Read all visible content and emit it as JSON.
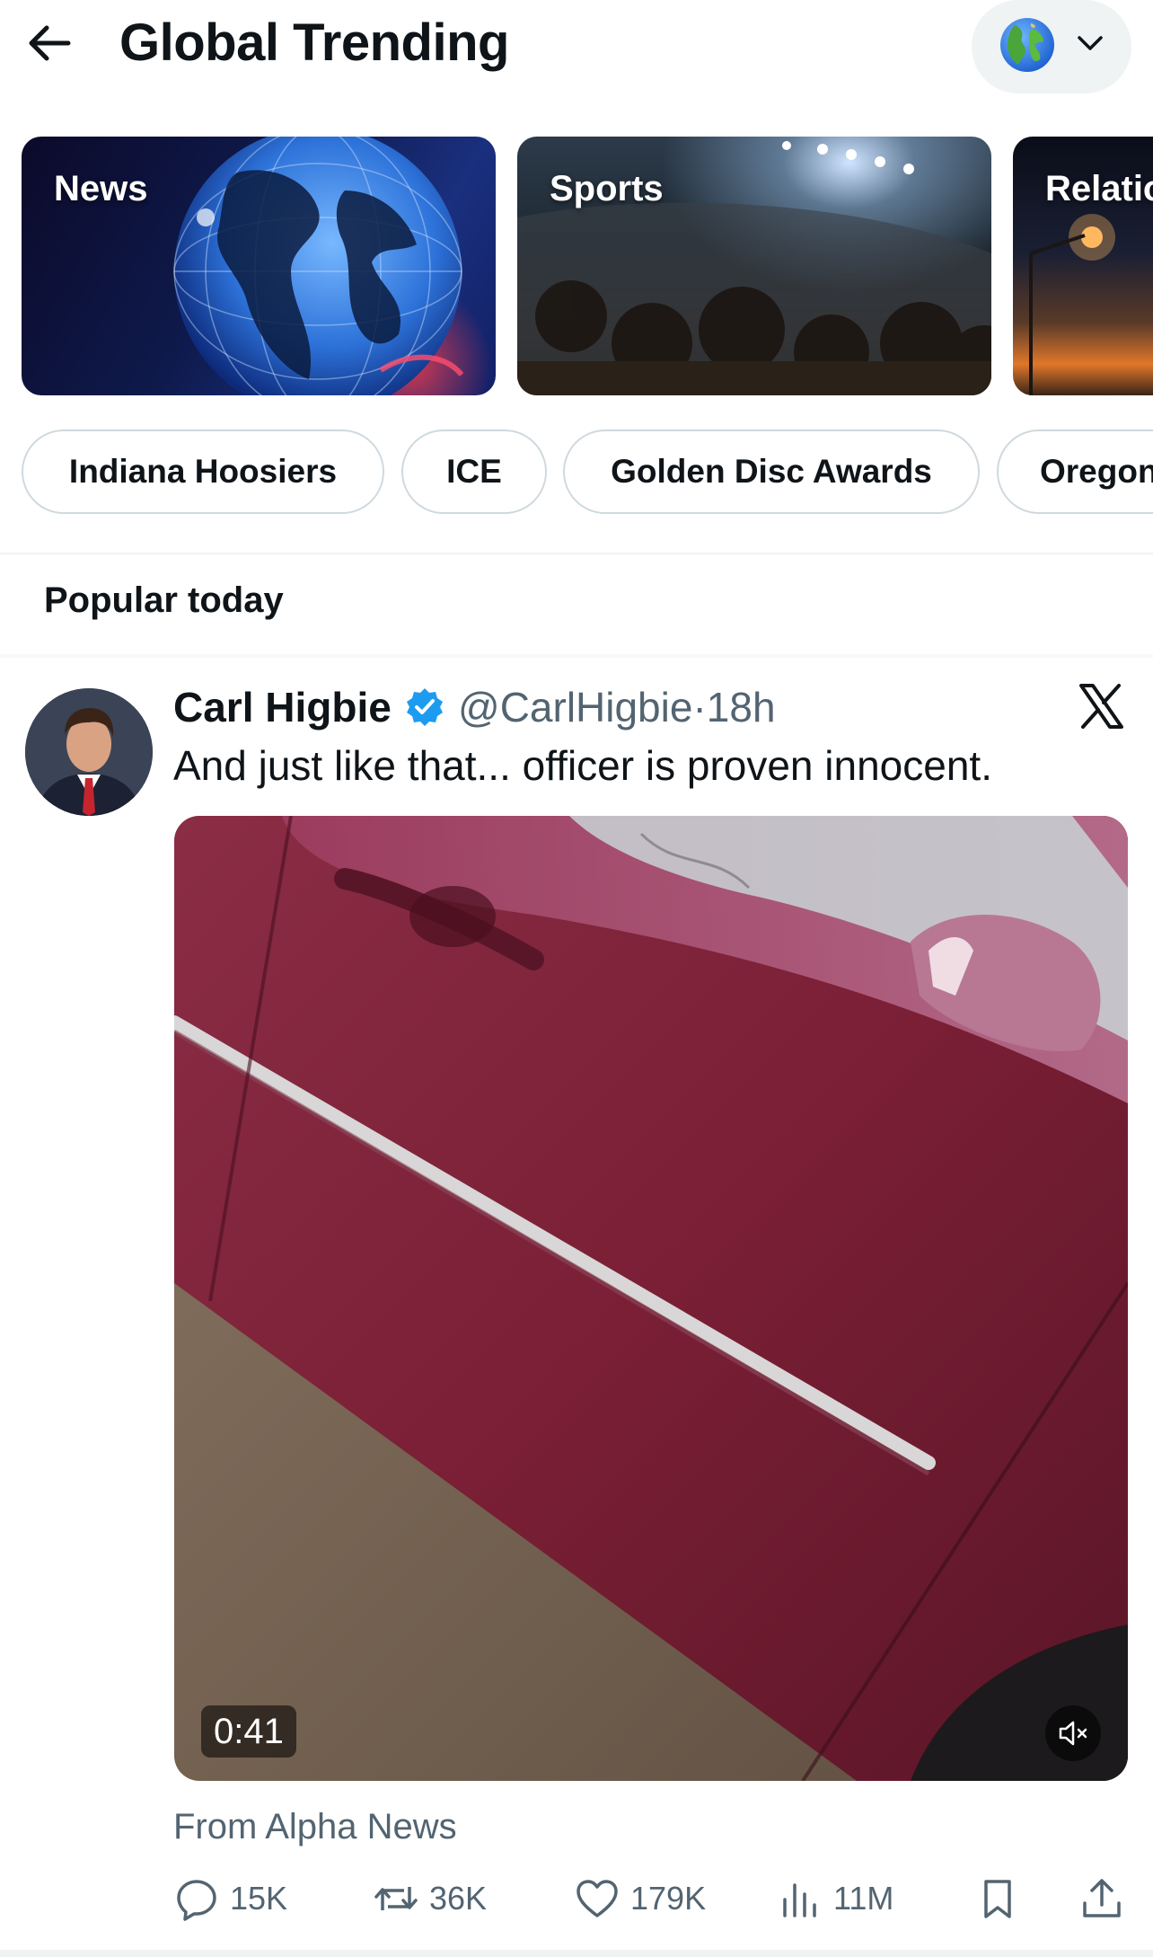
{
  "header": {
    "title": "Global Trending",
    "region_icon": "globe-icon",
    "back_icon": "arrow-left-icon"
  },
  "categories": [
    {
      "label": "News"
    },
    {
      "label": "Sports"
    },
    {
      "label": "Relatio"
    }
  ],
  "chips": [
    {
      "label": "Indiana Hoosiers"
    },
    {
      "label": "ICE"
    },
    {
      "label": "Golden Disc Awards"
    },
    {
      "label": "Oregon"
    }
  ],
  "section": {
    "title": "Popular today"
  },
  "tweet": {
    "name": "Carl Higbie",
    "handle": "@CarlHigbie",
    "separator": "·",
    "time": "18h",
    "text": "And just like that... officer is proven innocent.",
    "video_duration": "0:41",
    "source": "From Alpha News",
    "stats": {
      "replies": "15K",
      "reposts": "36K",
      "likes": "179K",
      "views": "11M"
    }
  },
  "colors": {
    "accent": "#1d9bf0",
    "text_primary": "#0f1419",
    "text_secondary": "#536471",
    "chip_border": "#cfd9de"
  }
}
